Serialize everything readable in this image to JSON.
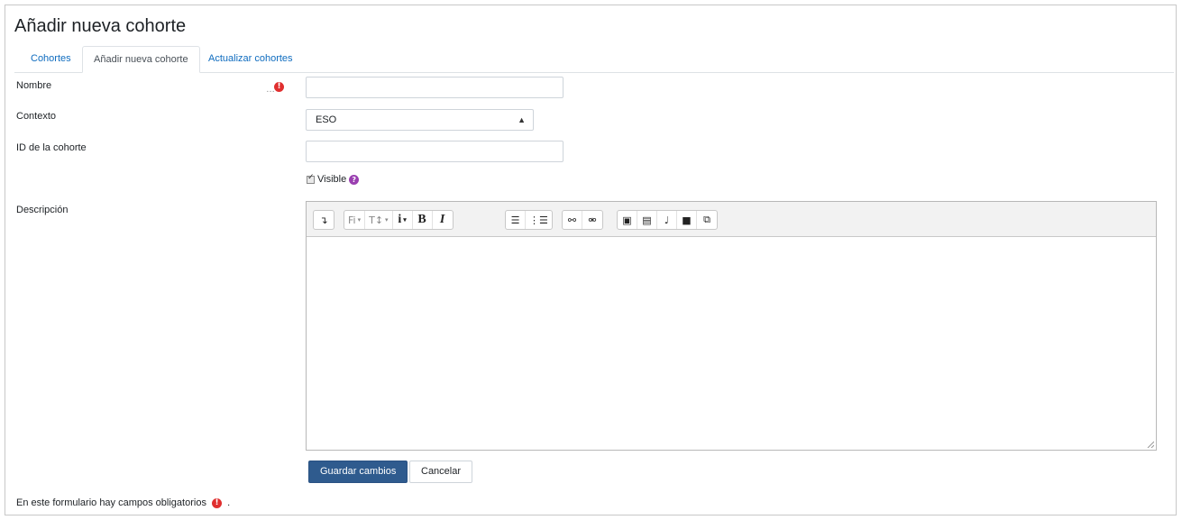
{
  "page": {
    "title": "Añadir nueva cohorte"
  },
  "tabs": [
    {
      "label": "Cohortes",
      "active": false
    },
    {
      "label": "Añadir nueva cohorte",
      "active": true
    },
    {
      "label": "Actualizar cohortes",
      "active": false
    }
  ],
  "form": {
    "name": {
      "label": "Nombre",
      "value": "",
      "required_icon": "!"
    },
    "context": {
      "label": "Contexto",
      "selected": "ESO"
    },
    "cohort_id": {
      "label": "ID de la cohorte",
      "value": ""
    },
    "visible": {
      "label": "Visible",
      "checked": true,
      "help_icon": "?"
    },
    "description": {
      "label": "Descripción",
      "value": ""
    }
  },
  "toolbar": {
    "groups": [
      [
        {
          "name": "collapse-icon",
          "glyph": "↴"
        }
      ],
      [
        {
          "name": "font-family-icon",
          "glyph": "Fi",
          "caret": true
        },
        {
          "name": "font-size-icon",
          "glyph": "T↕",
          "caret": true
        },
        {
          "name": "info-icon",
          "glyph": "i",
          "caret": true
        },
        {
          "name": "bold-icon",
          "glyph": "B"
        },
        {
          "name": "italic-icon",
          "glyph": "I"
        }
      ],
      [
        {
          "name": "unordered-list-icon",
          "glyph": "☰"
        },
        {
          "name": "ordered-list-icon",
          "glyph": "⋮☰"
        }
      ],
      [
        {
          "name": "link-icon",
          "glyph": "⚯"
        },
        {
          "name": "unlink-icon",
          "glyph": "⚮"
        }
      ],
      [
        {
          "name": "image-icon",
          "glyph": "▣"
        },
        {
          "name": "media-icon",
          "glyph": "▤"
        },
        {
          "name": "microphone-icon",
          "glyph": "♩"
        },
        {
          "name": "video-icon",
          "glyph": "■"
        },
        {
          "name": "copy-icon",
          "glyph": "⧉"
        }
      ]
    ],
    "caret": "▾"
  },
  "buttons": {
    "save": "Guardar cambios",
    "cancel": "Cancelar"
  },
  "footer": {
    "required_note": "En este formulario hay campos obligatorios",
    "suffix": ".",
    "required_icon": "!"
  },
  "colors": {
    "primary": "#2f5b8e",
    "required": "#e02f2f",
    "help": "#9a3fb0",
    "link": "#0f6cbf"
  }
}
